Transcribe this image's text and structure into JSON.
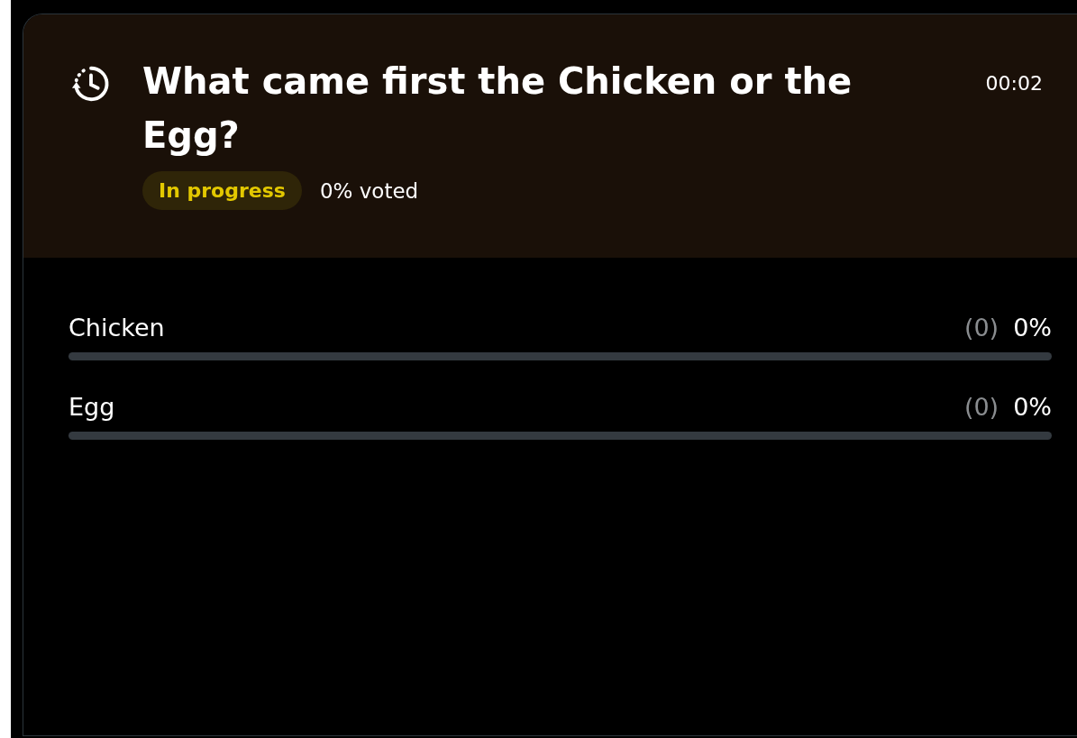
{
  "poll": {
    "question": "What came first the Chicken or the Egg?",
    "timer": "00:02",
    "status": {
      "label": "In progress",
      "kind": "progress"
    },
    "voted": "0% voted",
    "options": [
      {
        "label": "Chicken",
        "count": "(0)",
        "percent": "0%",
        "level": 0
      },
      {
        "label": "Egg",
        "count": "(0)",
        "percent": "0%",
        "level": 0
      }
    ]
  }
}
